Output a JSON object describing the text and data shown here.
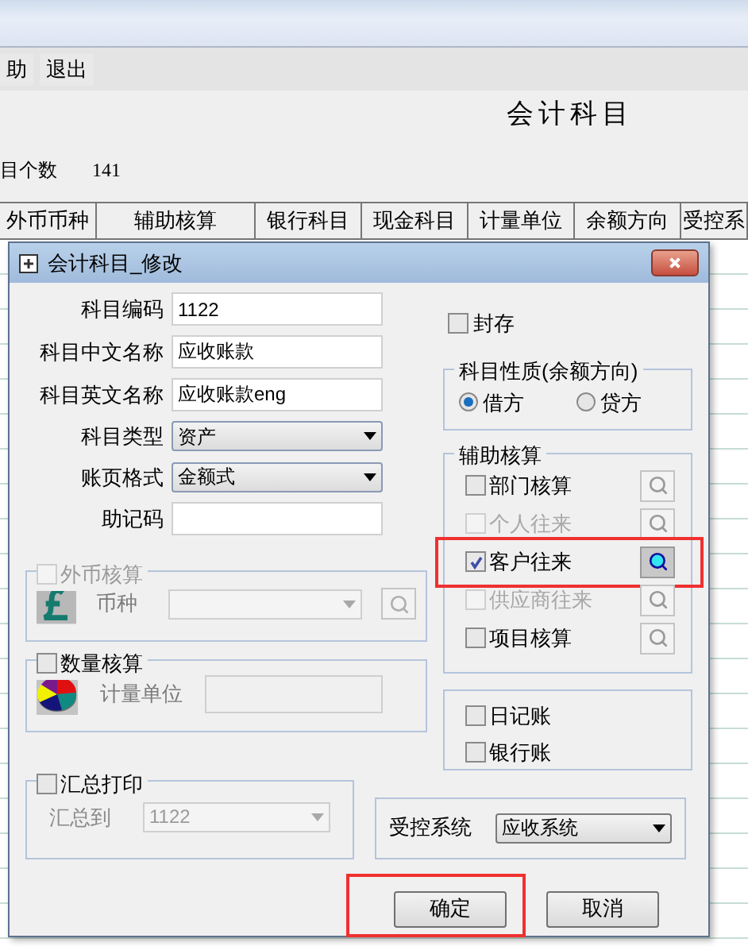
{
  "toolbar": [
    {
      "label": "助"
    },
    {
      "label": "退出"
    }
  ],
  "page_title": "会计科目",
  "count": {
    "label": "目个数",
    "value": "141"
  },
  "table": {
    "columns": [
      "外币币种",
      "辅助核算",
      "银行科目",
      "现金科目",
      "计量单位",
      "余额方向",
      "受控系"
    ]
  },
  "dialog": {
    "title": "会计科目_修改",
    "fields": [
      {
        "kind": "text",
        "label": "科目编码",
        "value": "1122"
      },
      {
        "kind": "text",
        "label": "科目中文名称",
        "value": "应收账款"
      },
      {
        "kind": "text",
        "label": "科目英文名称",
        "value": "应收账款eng"
      },
      {
        "kind": "select",
        "label": "科目类型",
        "value": "资产"
      },
      {
        "kind": "select",
        "label": "账页格式",
        "value": "金额式"
      },
      {
        "kind": "text",
        "label": "助记码"
      }
    ],
    "archived": {
      "label": "封存",
      "checked": false
    },
    "nature": {
      "title": "科目性质(余额方向)",
      "options": [
        {
          "label": "借方",
          "selected": true
        },
        {
          "label": "贷方",
          "selected": false
        }
      ]
    },
    "aux": {
      "title": "辅助核算",
      "items": [
        {
          "label": "部门核算",
          "checked": false,
          "disabled": false,
          "highlighted": false
        },
        {
          "label": "个人往来",
          "checked": false,
          "disabled": true,
          "highlighted": false
        },
        {
          "label": "客户往来",
          "checked": true,
          "disabled": false,
          "highlighted": true
        },
        {
          "label": "供应商往来",
          "checked": false,
          "disabled": true,
          "highlighted": false
        },
        {
          "label": "项目核算",
          "checked": false,
          "disabled": false,
          "highlighted": false
        }
      ]
    },
    "foreign": {
      "label": "外币核算",
      "checked": false,
      "field_label": "币种"
    },
    "quantity": {
      "label": "数量核算",
      "checked": false,
      "field_label": "计量单位"
    },
    "summary": {
      "label": "汇总打印",
      "checked": false,
      "field_label": "汇总到",
      "value": "1122"
    },
    "books": [
      {
        "label": "日记账",
        "checked": false
      },
      {
        "label": "银行账",
        "checked": false
      }
    ],
    "control": {
      "label": "受控系统",
      "value": "应收系统"
    },
    "buttons": [
      {
        "label": "确定",
        "highlighted": true
      },
      {
        "label": "取消",
        "highlighted": false
      }
    ]
  }
}
